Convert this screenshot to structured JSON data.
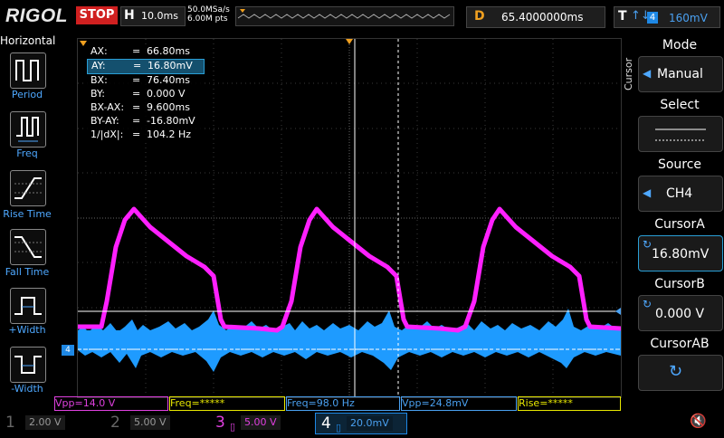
{
  "header": {
    "brand": "RIGOL",
    "run_state": "STOP",
    "timebase_label": "H",
    "timebase_value": "10.0ms",
    "sample_rate": "50.0MSa/s",
    "memory_depth": "6.00M pts",
    "delay_label": "D",
    "delay_value": "65.4000000ms",
    "trigger_label": "T",
    "trigger_edge": "↑↓",
    "trigger_source": "4",
    "trigger_level": "160mV"
  },
  "left_panel": {
    "title": "Horizontal",
    "items": [
      {
        "label": "Period"
      },
      {
        "label": "Freq"
      },
      {
        "label": "Rise Time"
      },
      {
        "label": "Fall Time"
      },
      {
        "label": "+Width"
      },
      {
        "label": "-Width"
      }
    ]
  },
  "cursor_readout": [
    {
      "key": "AX:",
      "value": "66.80ms"
    },
    {
      "key": "AY:",
      "value": "16.80mV"
    },
    {
      "key": "BX:",
      "value": "76.40ms"
    },
    {
      "key": "BY:",
      "value": "0.000 V"
    },
    {
      "key": "BX-AX:",
      "value": "9.600ms"
    },
    {
      "key": "BY-AY:",
      "value": "-16.80mV"
    },
    {
      "key": "1/|dX|:",
      "value": "104.2 Hz"
    }
  ],
  "right_panel": {
    "side_label": "Cursor",
    "mode_title": "Mode",
    "mode_value": "Manual",
    "select_title": "Select",
    "source_title": "Source",
    "source_value": "CH4",
    "cursor_a_title": "CursorA",
    "cursor_a_value": "16.80mV",
    "cursor_b_title": "CursorB",
    "cursor_b_value": "0.000 V",
    "cursor_ab_title": "CursorAB"
  },
  "measurements": [
    {
      "text": "Vpp=14.0 V",
      "color": "#e040e0"
    },
    {
      "text": "Freq=*****",
      "color": "#e8e800"
    },
    {
      "text": "Freq=98.0 Hz",
      "color": "#4aa0f0"
    },
    {
      "text": "Vpp=24.8mV",
      "color": "#4aa0f0"
    },
    {
      "text": "Rise=*****",
      "color": "#e8e800"
    }
  ],
  "channels": [
    {
      "num": "1",
      "scale": "2.00 V",
      "color": "#e8e800"
    },
    {
      "num": "2",
      "scale": "5.00 V",
      "color": "#00e8e8"
    },
    {
      "num": "3",
      "scale": "5.00 V",
      "color": "#e040e0"
    },
    {
      "num": "4",
      "scale": "20.0mV",
      "color": "#1e88e5"
    }
  ],
  "markers": {
    "ch4_marker": "4"
  },
  "colors": {
    "ch3": "#ff20ff",
    "ch4": "#1e9bff",
    "accent": "#f0a020"
  }
}
